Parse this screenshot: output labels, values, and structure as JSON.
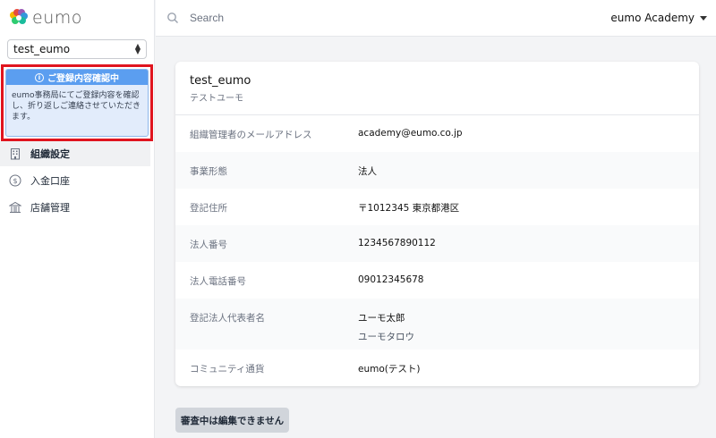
{
  "app": {
    "logo_text": "eumo"
  },
  "sidebar": {
    "org_select": {
      "value": "test_eumo"
    },
    "notice": {
      "title": "ご登録内容確認中",
      "body": "eumo事務局にてご登録内容を確認し、折り返しご連絡させていただきます。"
    },
    "items": [
      {
        "label": "組織設定",
        "icon": "building-icon",
        "active": true
      },
      {
        "label": "入金口座",
        "icon": "dollar-icon",
        "active": false
      },
      {
        "label": "店舗管理",
        "icon": "store-icon",
        "active": false
      }
    ]
  },
  "topbar": {
    "search_placeholder": "Search",
    "account_label": "eumo Academy"
  },
  "card": {
    "title": "test_eumo",
    "subtitle": "テストユーモ",
    "rows": [
      {
        "label": "組織管理者のメールアドレス",
        "value": "academy@eumo.co.jp"
      },
      {
        "label": "事業形態",
        "value": "法人"
      },
      {
        "label": "登記住所",
        "value": "〒1012345 東京都港区"
      },
      {
        "label": "法人番号",
        "value": "1234567890112"
      },
      {
        "label": "法人電話番号",
        "value": "09012345678"
      },
      {
        "label": "登記法人代表者名",
        "value": "ユーモ太郎",
        "value_sub": "ユーモタロウ"
      },
      {
        "label": "コミュニティ通貨",
        "value": "eumo(テスト)"
      }
    ]
  },
  "actions": {
    "edit_disabled_label": "審査中は編集できません"
  },
  "colors": {
    "notice_header": "#5b9ef0",
    "highlight_border": "#e0141e"
  }
}
